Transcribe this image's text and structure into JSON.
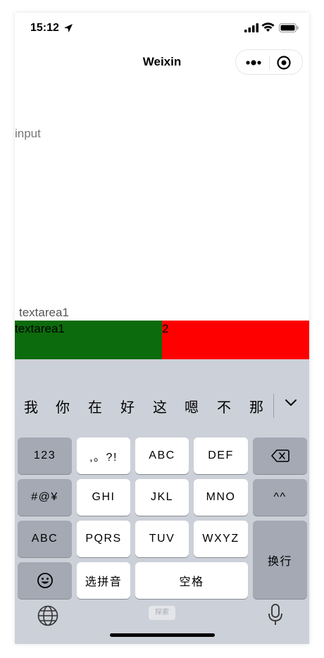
{
  "status": {
    "time": "15:12"
  },
  "nav": {
    "title": "Weixin"
  },
  "content": {
    "input_placeholder": "input",
    "textarea_label": "textarea1",
    "textarea1_value": "textarea1",
    "textarea2_value": "2",
    "colors": {
      "green": "#0c6b0c",
      "red": "#ff0000"
    }
  },
  "keyboard": {
    "candidates": [
      "我",
      "你",
      "在",
      "好",
      "这",
      "嗯",
      "不",
      "那"
    ],
    "keys": {
      "num": "123",
      "punct": ",。?!",
      "abc": "ABC",
      "def": "DEF",
      "symbols": "#@¥",
      "ghi": "GHI",
      "jkl": "JKL",
      "mno": "MNO",
      "face": "^^",
      "abc_switch": "ABC",
      "pqrs": "PQRS",
      "tuv": "TUV",
      "wxyz": "WXYZ",
      "return": "换行",
      "pinyin": "选拼音",
      "space": "空格"
    },
    "center_mark": "探索"
  }
}
